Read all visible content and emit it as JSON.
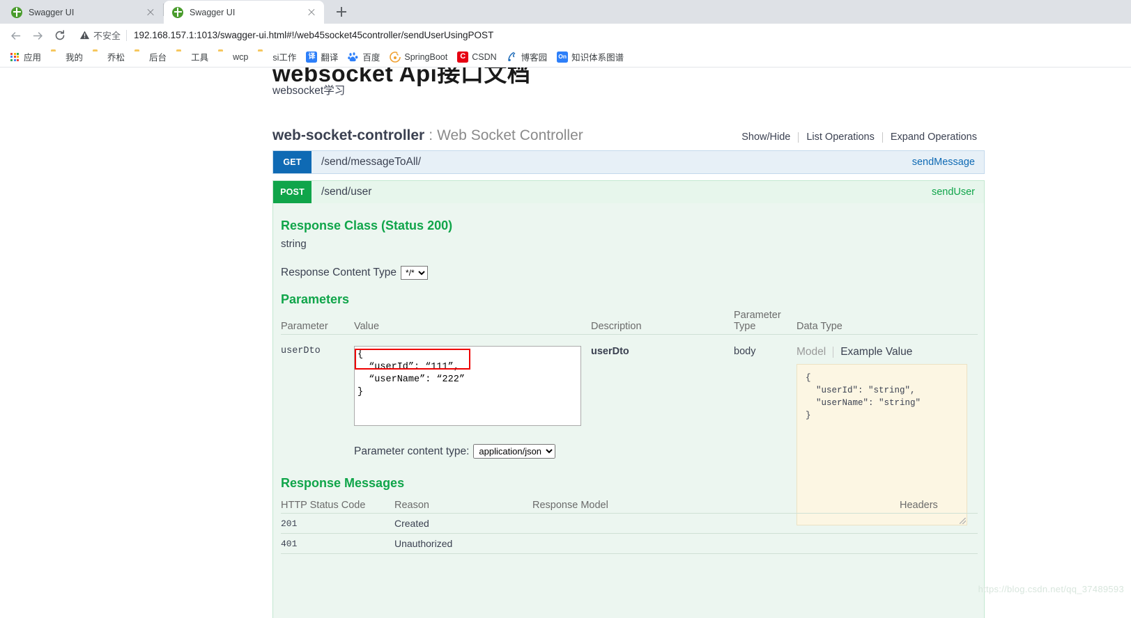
{
  "browser": {
    "tabs": [
      {
        "title": "Swagger UI",
        "active": false,
        "favicon": "swagger-favicon"
      },
      {
        "title": "Swagger UI",
        "active": true,
        "favicon": "swagger-favicon"
      }
    ],
    "new_tab_label": "+",
    "omnibox": {
      "security_label": "不安全",
      "url": "192.168.157.1:1013/swagger-ui.html#!/web45socket45controller/sendUserUsingPOST"
    },
    "bookmarks": [
      {
        "label": "应用",
        "icon": "apps-grid-icon",
        "color": "#4285f4"
      },
      {
        "label": "我的",
        "icon": "folder-icon",
        "color": "#f6c75e"
      },
      {
        "label": "乔松",
        "icon": "folder-icon",
        "color": "#f6c75e"
      },
      {
        "label": "后台",
        "icon": "folder-icon",
        "color": "#f6c75e"
      },
      {
        "label": "工具",
        "icon": "folder-icon",
        "color": "#f6c75e"
      },
      {
        "label": "wcp",
        "icon": "folder-icon",
        "color": "#f6c75e"
      },
      {
        "label": "si工作",
        "icon": "folder-icon",
        "color": "#f6c75e"
      },
      {
        "label": "翻译",
        "icon": "translate-icon",
        "color": "#2d7ff9",
        "glyph": "译"
      },
      {
        "label": "百度",
        "icon": "baidu-icon",
        "color": "#2d7ff9",
        "glyph": "百"
      },
      {
        "label": "SpringBoot",
        "icon": "springboot-icon",
        "color": "#f0a030",
        "glyph": ""
      },
      {
        "label": "CSDN",
        "icon": "csdn-icon",
        "color": "#e60012",
        "glyph": "C"
      },
      {
        "label": "博客园",
        "icon": "cnblogs-icon",
        "color": "#1e6bb8",
        "glyph": ""
      },
      {
        "label": "知识体系图谱",
        "icon": "atlas-icon",
        "color": "#2d7ff9",
        "glyph": "On"
      }
    ]
  },
  "page": {
    "api_title": "websocket  Api接口文档",
    "api_subtitle": "websocket学习",
    "resource": {
      "name": "web-socket-controller",
      "colon": ":",
      "description": "Web Socket Controller",
      "options": [
        "Show/Hide",
        "List Operations",
        "Expand Operations"
      ]
    },
    "operations": [
      {
        "method": "GET",
        "path": "/send/messageToAll/",
        "nickname": "sendMessage"
      },
      {
        "method": "POST",
        "path": "/send/user",
        "nickname": "sendUser"
      }
    ],
    "post_detail": {
      "response_class_title": "Response Class (Status 200)",
      "response_type": "string",
      "response_content_type_label": "Response Content Type",
      "response_content_type_value": "*/*",
      "parameters_title": "Parameters",
      "param_columns": [
        "Parameter",
        "Value",
        "Description",
        "Parameter Type",
        "Data Type"
      ],
      "param_rows": [
        {
          "parameter": "userDto",
          "value": "{\n  “userId”: “111”,\n  “userName”: “222”\n}",
          "description": "userDto",
          "parameter_type": "body"
        }
      ],
      "parameter_content_type_label": "Parameter content type:",
      "parameter_content_type_value": "application/json",
      "model_tab": "Model",
      "example_tab": "Example Value",
      "example_value": "{\n  \"userId\": \"string\",\n  \"userName\": \"string\"\n}",
      "example_value_lines": [
        {
          "text": "{",
          "kind": "plain"
        },
        {
          "text": "  \"userId\": \"string\",",
          "kind": "kv"
        },
        {
          "text": "  \"userName\": \"string\"",
          "kind": "kv"
        },
        {
          "text": "}",
          "kind": "plain"
        }
      ],
      "response_messages_title": "Response Messages",
      "response_columns": [
        "HTTP Status Code",
        "Reason",
        "Response Model",
        "Headers"
      ],
      "response_rows": [
        {
          "code": "201",
          "reason": "Created",
          "model": "",
          "headers": ""
        },
        {
          "code": "401",
          "reason": "Unauthorized",
          "model": "",
          "headers": ""
        }
      ]
    },
    "watermark": "https://blog.csdn.net/qq_37489593"
  },
  "colors": {
    "get": "#0f6ab4",
    "post": "#10a54a",
    "annotation": "#ee0000",
    "example_bg": "#fcf6e3"
  }
}
